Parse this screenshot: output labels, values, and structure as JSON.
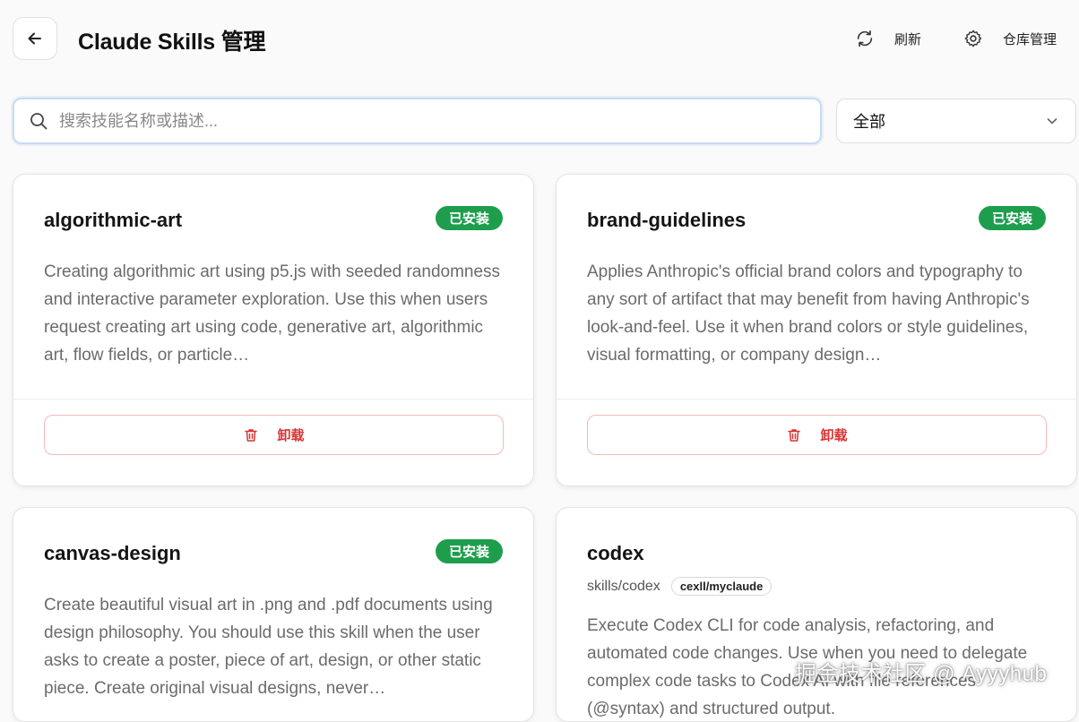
{
  "header": {
    "title": "Claude Skills 管理",
    "refresh_label": "刷新",
    "repo_manage_label": "仓库管理"
  },
  "search": {
    "placeholder": "搜索技能名称或描述...",
    "value": ""
  },
  "filter": {
    "selected": "全部"
  },
  "cards": [
    {
      "name": "algorithmic-art",
      "badge": "已安装",
      "description": "Creating algorithmic art using p5.js with seeded randomness and interactive parameter exploration. Use this when users request creating art using code, generative art, algorithmic art, flow fields, or particle…",
      "action_label": "卸载"
    },
    {
      "name": "brand-guidelines",
      "badge": "已安装",
      "description": "Applies Anthropic's official brand colors and typography to any sort of artifact that may benefit from having Anthropic's look-and-feel. Use it when brand colors or style guidelines, visual formatting, or company design…",
      "action_label": "卸载"
    },
    {
      "name": "canvas-design",
      "badge": "已安装",
      "description": "Create beautiful visual art in .png and .pdf documents using design philosophy. You should use this skill when the user asks to create a poster, piece of art, design, or other static piece. Create original visual designs, never…"
    },
    {
      "name": "codex",
      "path": "skills/codex",
      "repo": "cexll/myclaude",
      "description": "Execute Codex CLI for code analysis, refactoring, and automated code changes. Use when you need to delegate complex code tasks to Codex AI with file references (@syntax) and structured output."
    }
  ],
  "watermark": "掘金技术社区 @ Ayyyhub",
  "colors": {
    "installed_badge": "#1e9e4d",
    "uninstall_red": "#d83434",
    "search_focus_border": "#c7dbf3"
  },
  "icons": {
    "back": "arrow-left-icon",
    "refresh": "refresh-icon",
    "settings": "gear-icon",
    "search": "search-icon",
    "dropdown": "chevron-down-icon",
    "uninstall": "trash-icon"
  }
}
